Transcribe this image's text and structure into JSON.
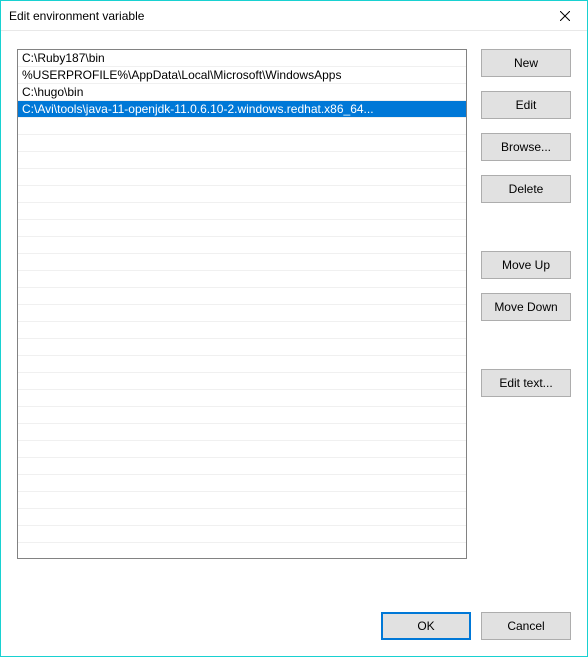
{
  "titlebar": {
    "title": "Edit environment variable"
  },
  "list": {
    "items": [
      {
        "text": "C:\\Ruby187\\bin",
        "selected": false
      },
      {
        "text": "%USERPROFILE%\\AppData\\Local\\Microsoft\\WindowsApps",
        "selected": false
      },
      {
        "text": "C:\\hugo\\bin",
        "selected": false
      },
      {
        "text": "C:\\Avi\\tools\\java-11-openjdk-11.0.6.10-2.windows.redhat.x86_64...",
        "selected": true
      }
    ]
  },
  "buttons": {
    "new": "New",
    "edit": "Edit",
    "browse": "Browse...",
    "delete": "Delete",
    "move_up": "Move Up",
    "move_down": "Move Down",
    "edit_text": "Edit text...",
    "ok": "OK",
    "cancel": "Cancel"
  }
}
